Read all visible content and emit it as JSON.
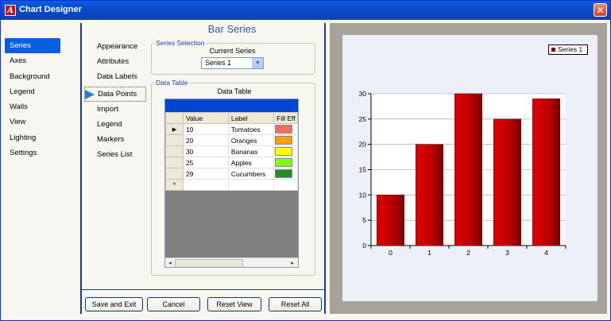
{
  "window": {
    "title": "Chart Designer",
    "icon_letter": "A",
    "close_glyph": "✕"
  },
  "sidebar": {
    "items": [
      {
        "label": "Series"
      },
      {
        "label": "Axes"
      },
      {
        "label": "Background"
      },
      {
        "label": "Legend"
      },
      {
        "label": "Walls"
      },
      {
        "label": "View"
      },
      {
        "label": "Lighting"
      },
      {
        "label": "Settings"
      }
    ],
    "selected": "Series"
  },
  "subnav": {
    "items": [
      {
        "label": "Appearance"
      },
      {
        "label": "Attributes"
      },
      {
        "label": "Data Labels"
      },
      {
        "label": "Data Points"
      },
      {
        "label": "Import"
      },
      {
        "label": "Legend"
      },
      {
        "label": "Markers"
      },
      {
        "label": "Series List"
      }
    ],
    "selected": "Data Points"
  },
  "panel": {
    "heading": "Bar Series",
    "series_selection": {
      "group_label": "Series Selection",
      "field_label": "Current Series",
      "value": "Series 1"
    },
    "data_table": {
      "group_label": "Data Table",
      "caption": "Data Table",
      "columns": [
        "Value",
        "Label",
        "Fill Eff"
      ],
      "rows": [
        {
          "value": "10",
          "label": "Tomatoes",
          "color": "#ff6a5a"
        },
        {
          "value": "20",
          "label": "Oranges",
          "color": "#ff9f00"
        },
        {
          "value": "30",
          "label": "Bananas",
          "color": "#ffff00"
        },
        {
          "value": "25",
          "label": "Apples",
          "color": "#80ff00"
        },
        {
          "value": "29",
          "label": "Cucumbers",
          "color": "#228b22"
        }
      ],
      "current_row_marker": "▶",
      "new_row_marker": "*"
    }
  },
  "buttons": {
    "save_exit": "Save and Exit",
    "cancel": "Cancel",
    "reset_view": "Reset View",
    "reset_all": "Reset All"
  },
  "chart_data": {
    "type": "bar",
    "categories": [
      "0",
      "1",
      "2",
      "3",
      "4"
    ],
    "series": [
      {
        "name": "Series 1",
        "values": [
          10,
          20,
          30,
          25,
          29
        ],
        "color": "#cc0000"
      }
    ],
    "ylim": [
      0,
      30
    ],
    "yticks": [
      "0",
      "5",
      "10",
      "15",
      "20",
      "25",
      "30"
    ],
    "grid": true,
    "legend_placement": "top-right"
  }
}
